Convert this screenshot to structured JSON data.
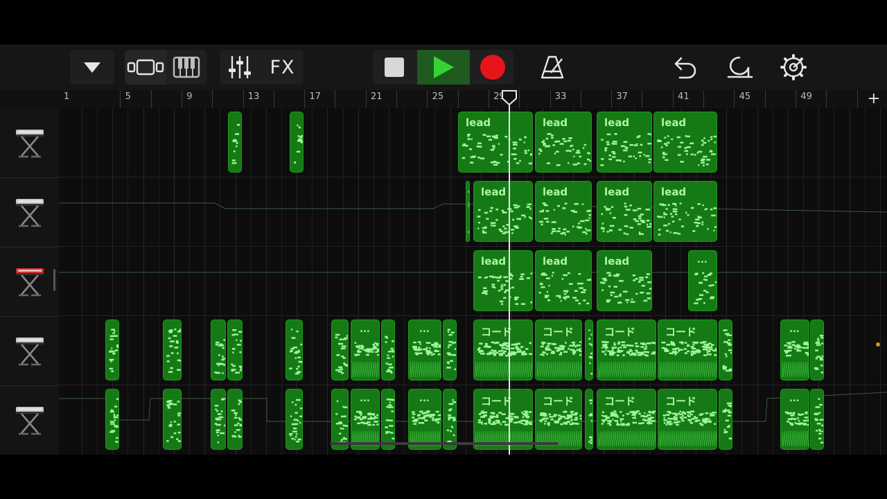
{
  "toolbar": {
    "buttons": [
      {
        "name": "tracks-menu-button",
        "icon": "triangle-down-icon"
      },
      {
        "name": "tracks-view-button",
        "icon": "tracks-view-icon"
      },
      {
        "name": "keyboard-button",
        "icon": "piano-keys-icon"
      },
      {
        "name": "mixer-button",
        "icon": "mixer-sliders-icon"
      },
      {
        "name": "fx-button",
        "label": "FX"
      },
      {
        "name": "stop-button",
        "icon": "stop-icon"
      },
      {
        "name": "play-button",
        "icon": "play-icon"
      },
      {
        "name": "record-button",
        "icon": "record-icon"
      },
      {
        "name": "metronome-button",
        "icon": "metronome-icon"
      },
      {
        "name": "undo-button",
        "icon": "undo-icon"
      },
      {
        "name": "loop-browser-button",
        "icon": "loop-icon"
      },
      {
        "name": "settings-button",
        "icon": "gear-icon"
      }
    ],
    "fx_label": "FX"
  },
  "ruler": {
    "labels": [
      "1",
      "5",
      "9",
      "13",
      "17",
      "21",
      "25",
      "29",
      "33",
      "37",
      "41",
      "45",
      "49"
    ],
    "add_label": "+"
  },
  "tracks": [
    {
      "name": "track-1",
      "icon": "keyboard-stand-icon",
      "color": "#c9c9c9"
    },
    {
      "name": "track-2",
      "icon": "keyboard-stand-icon",
      "color": "#c9c9c9"
    },
    {
      "name": "track-3",
      "icon": "keyboard-stand-icon",
      "color": "#d43030"
    },
    {
      "name": "track-4",
      "icon": "keyboard-stand-icon",
      "color": "#c9c9c9"
    },
    {
      "name": "track-5",
      "icon": "keyboard-stand-icon",
      "color": "#c9c9c9"
    }
  ],
  "regions": [
    {
      "track": 0,
      "label": ""
    },
    {
      "track": 0,
      "label": ""
    },
    {
      "track": 0,
      "label": "lead"
    },
    {
      "track": 0,
      "label": "lead"
    },
    {
      "track": 0,
      "label": "lead"
    },
    {
      "track": 0,
      "label": "lead"
    },
    {
      "track": 1,
      "label": ""
    },
    {
      "track": 1,
      "label": "lead"
    },
    {
      "track": 1,
      "label": "lead"
    },
    {
      "track": 1,
      "label": "lead"
    },
    {
      "track": 1,
      "label": "lead"
    },
    {
      "track": 2,
      "label": "lead"
    },
    {
      "track": 2,
      "label": "lead"
    },
    {
      "track": 2,
      "label": "lead"
    },
    {
      "track": 2,
      "label": "..."
    },
    {
      "track": 3,
      "label": ""
    },
    {
      "track": 3,
      "label": ""
    },
    {
      "track": 3,
      "label": ""
    },
    {
      "track": 3,
      "label": ""
    },
    {
      "track": 3,
      "label": ""
    },
    {
      "track": 3,
      "label": ""
    },
    {
      "track": 3,
      "label": "..."
    },
    {
      "track": 3,
      "label": ""
    },
    {
      "track": 3,
      "label": "..."
    },
    {
      "track": 3,
      "label": ""
    },
    {
      "track": 3,
      "label": "コード"
    },
    {
      "track": 3,
      "label": "コード"
    },
    {
      "track": 3,
      "label": ""
    },
    {
      "track": 3,
      "label": "コード"
    },
    {
      "track": 3,
      "label": "コード"
    },
    {
      "track": 3,
      "label": ""
    },
    {
      "track": 3,
      "label": "..."
    },
    {
      "track": 3,
      "label": ""
    },
    {
      "track": 4,
      "label": ""
    },
    {
      "track": 4,
      "label": ""
    },
    {
      "track": 4,
      "label": ""
    },
    {
      "track": 4,
      "label": ""
    },
    {
      "track": 4,
      "label": ""
    },
    {
      "track": 4,
      "label": ""
    },
    {
      "track": 4,
      "label": "..."
    },
    {
      "track": 4,
      "label": ""
    },
    {
      "track": 4,
      "label": "..."
    },
    {
      "track": 4,
      "label": ""
    },
    {
      "track": 4,
      "label": "コード"
    },
    {
      "track": 4,
      "label": "コード"
    },
    {
      "track": 4,
      "label": ""
    },
    {
      "track": 4,
      "label": "コード"
    },
    {
      "track": 4,
      "label": "コード"
    },
    {
      "track": 4,
      "label": ""
    },
    {
      "track": 4,
      "label": "..."
    },
    {
      "track": 4,
      "label": ""
    }
  ],
  "colors": {
    "region": "#157a15",
    "region_border": "#1e9a1e",
    "notes": "#9ff59a",
    "play_bg": "#1f5a1f",
    "record": "#e8141c",
    "indicator": "#e08a1e"
  }
}
